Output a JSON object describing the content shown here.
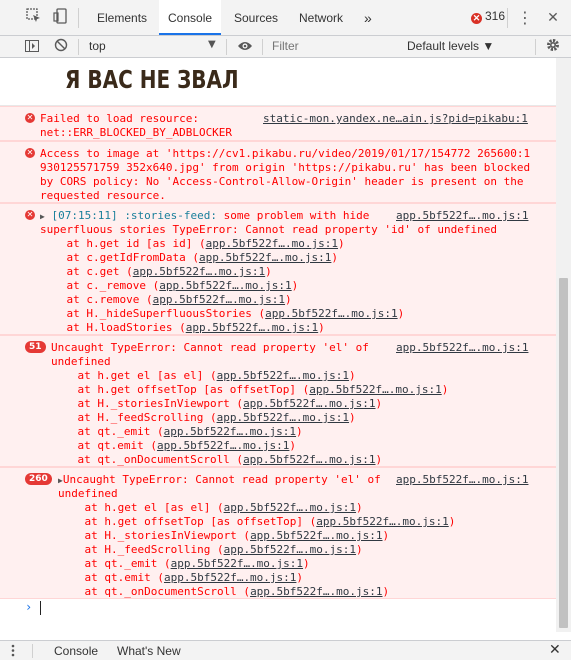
{
  "tabbar": {
    "inspect_icon": "inspect-icon",
    "device_icon": "device-toolbar-icon",
    "tabs": [
      {
        "label": "Elements"
      },
      {
        "label": "Console"
      },
      {
        "label": "Sources"
      },
      {
        "label": "Network"
      }
    ],
    "more": "»",
    "error_count": "316",
    "menu": "⋮",
    "close": "✕"
  },
  "toolbar": {
    "context": "top",
    "filter_placeholder": "Filter",
    "levels": "Default levels ▼",
    "settings_icon": "gear-icon"
  },
  "console": {
    "image_text": "Я ВАС НЕ ЗВАЛ",
    "messages": [
      {
        "lines": [
          "Failed to load resource:",
          "net::ERR_BLOCKED_BY_ADBLOCKER"
        ],
        "source": "static-mon.yandex.ne…ain.js?pid=pikabu:1"
      },
      {
        "lines": [
          "Access to image at 'https://cv1.pikabu.ru/video/2019/01/17/154772 265600:1",
          "930125571759 352x640.jpg' from origin 'https://pikabu.ru' has been blocked",
          "by CORS policy: No 'Access-Control-Allow-Origin' header is present on the",
          "requested resource."
        ]
      },
      {
        "timestamp": "[07:15:11]",
        "tag": ":stories-feed:",
        "text": " some problem with hide",
        "source": "app.5bf522f….mo.js:1",
        "lines": [
          "superfluous stories TypeError: Cannot read property 'id' of undefined"
        ],
        "stack": [
          {
            "fn": "    at h.get id [as id] (",
            "src": "app.5bf522f….mo.js:1"
          },
          {
            "fn": "    at c.getIdFromData (",
            "src": "app.5bf522f….mo.js:1"
          },
          {
            "fn": "    at c.get (",
            "src": "app.5bf522f….mo.js:1"
          },
          {
            "fn": "    at c._remove (",
            "src": "app.5bf522f….mo.js:1"
          },
          {
            "fn": "    at c.remove (",
            "src": "app.5bf522f….mo.js:1"
          },
          {
            "fn": "    at H._hideSuperfluousStories (",
            "src": "app.5bf522f….mo.js:1"
          },
          {
            "fn": "    at H.loadStories (",
            "src": "app.5bf522f….mo.js:1"
          }
        ]
      },
      {
        "count": "51",
        "text": "Uncaught TypeError: Cannot read property 'el' of",
        "source": "app.5bf522f….mo.js:1",
        "lines": [
          "undefined"
        ],
        "stack": [
          {
            "fn": "    at h.get el [as el] (",
            "src": "app.5bf522f….mo.js:1"
          },
          {
            "fn": "    at h.get offsetTop [as offsetTop] (",
            "src": "app.5bf522f….mo.js:1"
          },
          {
            "fn": "    at H._storiesInViewport (",
            "src": "app.5bf522f….mo.js:1"
          },
          {
            "fn": "    at H._feedScrolling (",
            "src": "app.5bf522f….mo.js:1"
          },
          {
            "fn": "    at qt._emit (",
            "src": "app.5bf522f….mo.js:1"
          },
          {
            "fn": "    at qt.emit (",
            "src": "app.5bf522f….mo.js:1"
          },
          {
            "fn": "    at qt._onDocumentScroll (",
            "src": "app.5bf522f….mo.js:1"
          }
        ]
      },
      {
        "count": "260",
        "text": "Uncaught TypeError: Cannot read property 'el' of",
        "source": "app.5bf522f….mo.js:1",
        "lines": [
          "undefined"
        ],
        "stack": [
          {
            "fn": "    at h.get el [as el] (",
            "src": "app.5bf522f….mo.js:1"
          },
          {
            "fn": "    at h.get offsetTop [as offsetTop] (",
            "src": "app.5bf522f….mo.js:1"
          },
          {
            "fn": "    at H._storiesInViewport (",
            "src": "app.5bf522f….mo.js:1"
          },
          {
            "fn": "    at H._feedScrolling (",
            "src": "app.5bf522f….mo.js:1"
          },
          {
            "fn": "    at qt._emit (",
            "src": "app.5bf522f….mo.js:1"
          },
          {
            "fn": "    at qt.emit (",
            "src": "app.5bf522f….mo.js:1"
          },
          {
            "fn": "    at qt._onDocumentScroll (",
            "src": "app.5bf522f….mo.js:1"
          }
        ]
      }
    ],
    "prompt": "›"
  },
  "drawer": {
    "tabs": [
      {
        "label": "Console"
      },
      {
        "label": "What's New"
      }
    ],
    "close": "✕"
  },
  "colors": {
    "error_text": "#ff0000",
    "error_bg": "#fff0f0",
    "accent": "#1a73e8",
    "badge": "#e53935"
  }
}
